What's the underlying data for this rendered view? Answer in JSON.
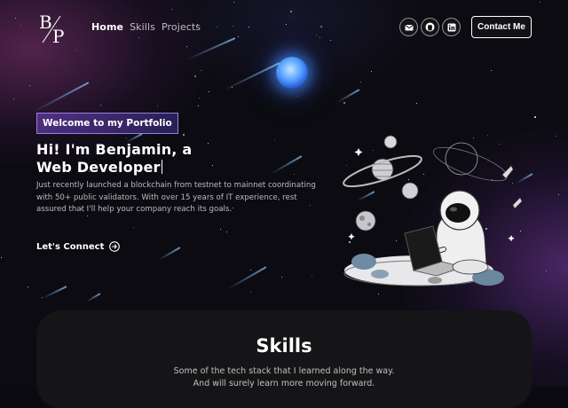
{
  "brand": {
    "logo_text": "B/P"
  },
  "nav": {
    "items": [
      {
        "label": "Home",
        "active": true
      },
      {
        "label": "Skills",
        "active": false
      },
      {
        "label": "Projects",
        "active": false
      }
    ]
  },
  "social": [
    {
      "icon": "mail-icon"
    },
    {
      "icon": "github-icon"
    },
    {
      "icon": "linkedin-icon"
    }
  ],
  "contact_button": {
    "label": "Contact Me"
  },
  "hero": {
    "tagline": "Welcome to my Portfolio",
    "headline_line1": "Hi! I'm Benjamin, a",
    "headline_line2": "Web Developer",
    "description": "Just recently launched a blockchain from testnet to mainnet coordinating with 50+ public validators. With over 15 years of IT experience, rest assured that I'll help your company reach its goals.",
    "cta": "Let's Connect"
  },
  "skills": {
    "title": "Skills",
    "subtitle_line1": "Some of the tech stack that I learned along the way.",
    "subtitle_line2": "And will surely learn more moving forward."
  },
  "colors": {
    "background": "#0c0b11",
    "tagline_border": "#aa96ff",
    "moon": "#4f9bff",
    "skills_panel": "#151517"
  }
}
